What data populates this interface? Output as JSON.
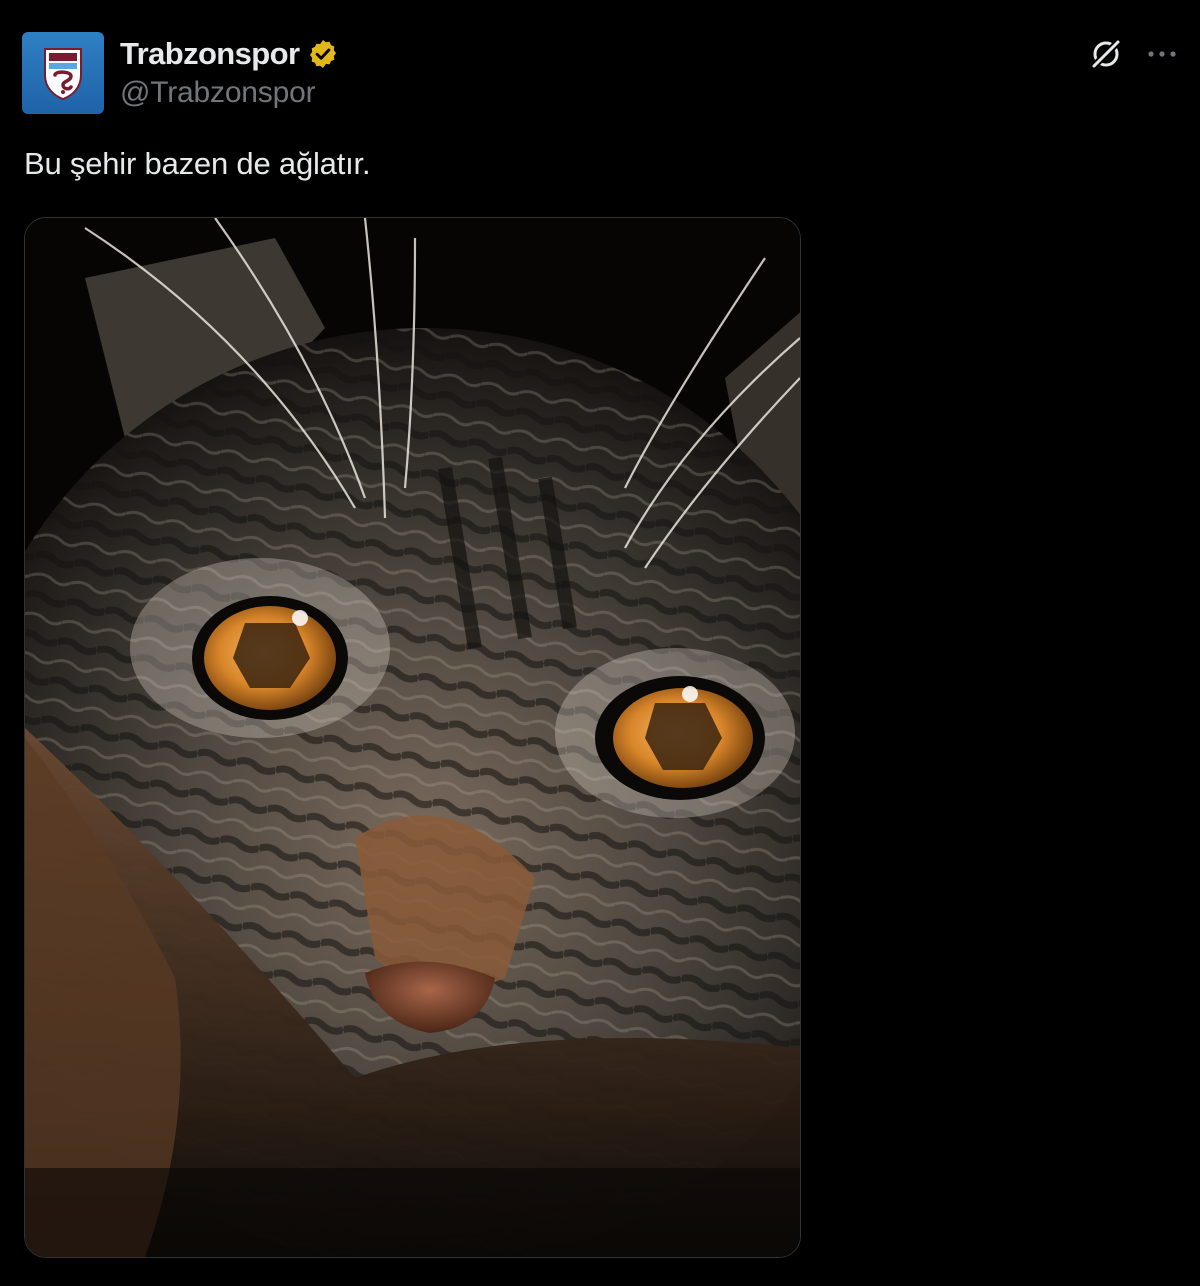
{
  "tweet": {
    "author": {
      "display_name": "Trabzonspor",
      "handle": "@Trabzonspor",
      "verified_badge_color": "#e2b719",
      "avatar_bg": "#2a74ba"
    },
    "text": "Bu şehir bazen de ağlatır.",
    "media": {
      "subject": "tabby cat face with tiger reflections in amber eyes"
    },
    "actions": {
      "grok_icon": "grok-icon",
      "more_icon": "more-icon"
    }
  },
  "colors": {
    "background": "#000000",
    "text_primary": "#e7e9ea",
    "text_secondary": "#71767b",
    "border": "#2f3336"
  }
}
